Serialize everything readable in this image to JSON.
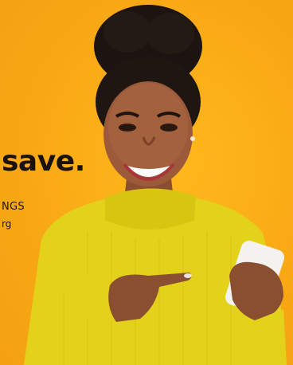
{
  "ad": {
    "headline": "save.",
    "tagline": "NGS",
    "url": "rg"
  },
  "colors": {
    "background": "#f9a915",
    "sweater": "#e4d21a",
    "text": "#1a1208"
  }
}
